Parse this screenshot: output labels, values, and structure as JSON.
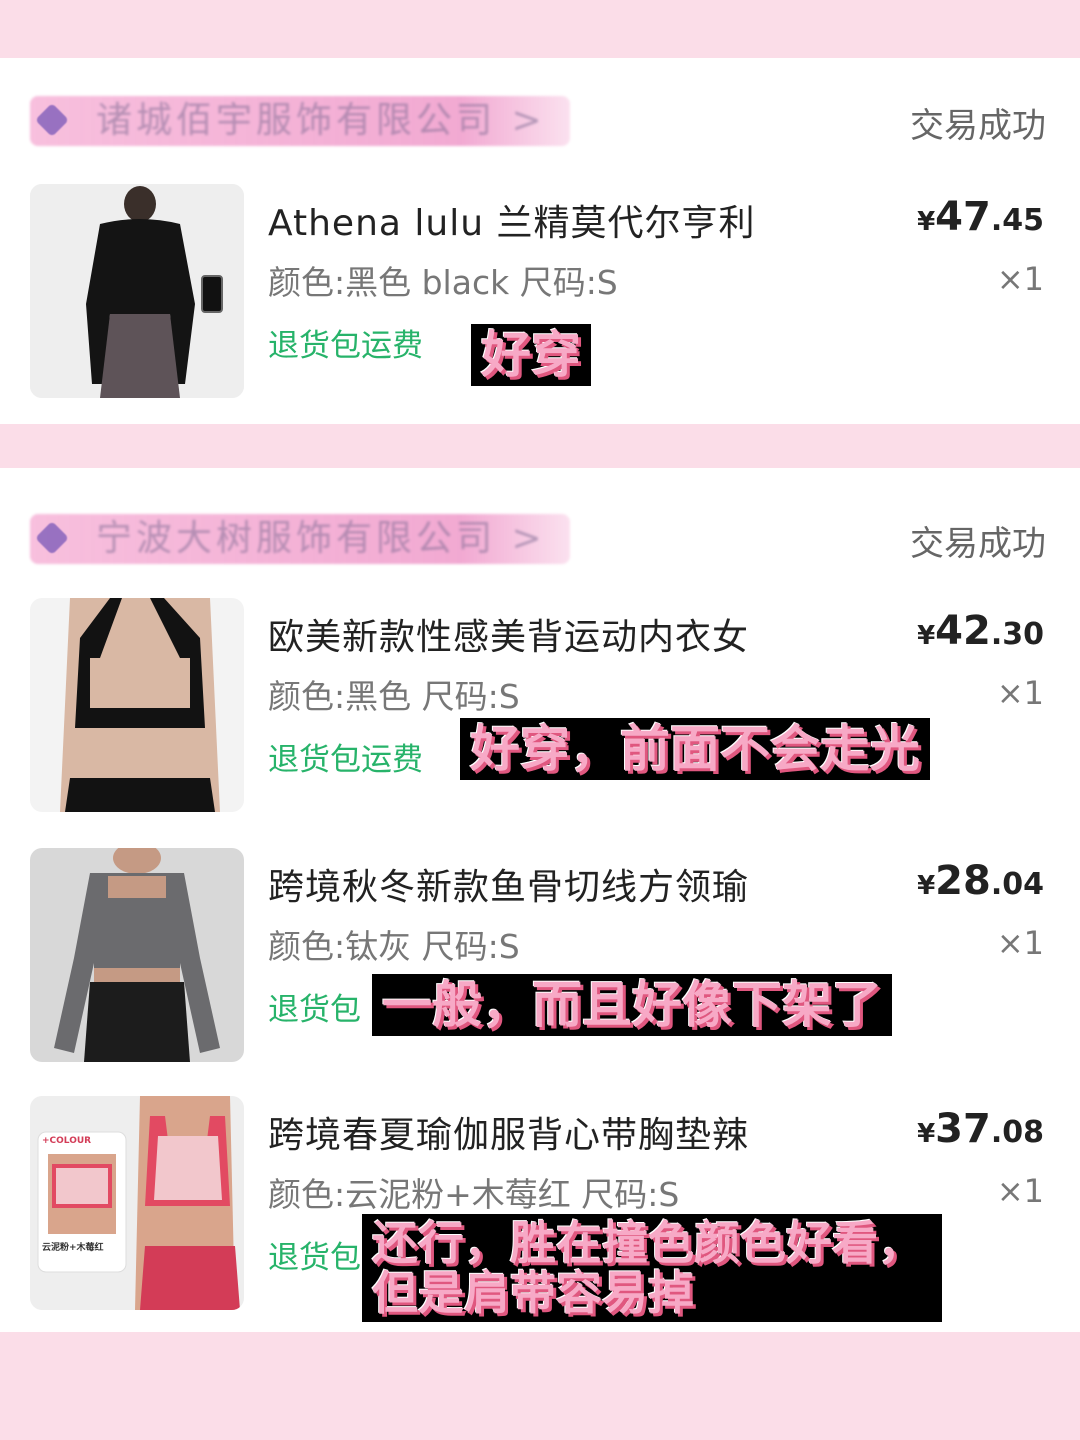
{
  "orders": [
    {
      "shop_name": "诸城佰宇服饰有限公司 >",
      "status": "交易成功",
      "items": [
        {
          "title": "Athena lulu 兰精莫代尔亨利",
          "spec": "颜色:黑色 black 尺码:S",
          "shipping": "退货包运费",
          "price_symbol": "¥",
          "price_int": "47",
          "price_dec": ".45",
          "qty": "×1",
          "comment": "好穿",
          "thumb_label": "black long-sleeve top"
        }
      ]
    },
    {
      "shop_name": "宁波大树服饰有限公司 >",
      "status": "交易成功",
      "items": [
        {
          "title": "欧美新款性感美背运动内衣女",
          "spec": "颜色:黑色 尺码:S",
          "shipping": "退货包运费",
          "price_symbol": "¥",
          "price_int": "42",
          "price_dec": ".30",
          "qty": "×1",
          "comment": "好穿，前面不会走光",
          "thumb_label": "black sports bra"
        },
        {
          "title": "跨境秋冬新款鱼骨切线方领瑜",
          "spec": "颜色:钛灰 尺码:S",
          "shipping": "退货包",
          "price_symbol": "¥",
          "price_int": "28",
          "price_dec": ".04",
          "qty": "×1",
          "comment": "一般，而且好像下架了",
          "thumb_label": "grey cropped yoga top"
        },
        {
          "title": "跨境春夏瑜伽服背心带胸垫辣",
          "spec": "颜色:云泥粉+木莓红 尺码:S",
          "shipping": "退货包",
          "price_symbol": "¥",
          "price_int": "37",
          "price_dec": ".08",
          "qty": "×1",
          "comment": "还行，胜在撞色颜色好看，但是肩带容易掉",
          "thumb_label": "pink and red yoga vest",
          "thumb_text_top": "+COLOUR",
          "thumb_text_bottom": "云泥粉+木莓红"
        }
      ]
    }
  ],
  "colors": {
    "page_bg": "#fbdde8",
    "card_bg": "#ffffff",
    "shipping_green": "#27b36a",
    "note_pink": "#f7a9c6"
  }
}
